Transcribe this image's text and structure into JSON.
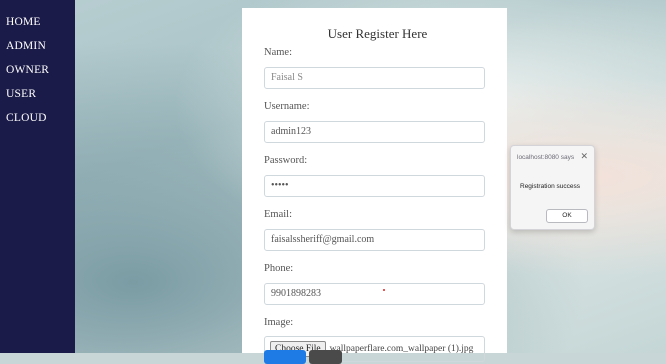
{
  "sidebar": {
    "items": [
      {
        "label": "HOME"
      },
      {
        "label": "ADMIN"
      },
      {
        "label": "OWNER"
      },
      {
        "label": "USER"
      },
      {
        "label": "CLOUD"
      }
    ]
  },
  "form": {
    "title": "User Register Here",
    "fields": {
      "name": {
        "label": "Name:",
        "value": "Faisal S"
      },
      "username": {
        "label": "Username:",
        "value": "admin123"
      },
      "password": {
        "label": "Password:",
        "value": "•••••"
      },
      "email": {
        "label": "Email:",
        "value": "faisalssheriff@gmail.com"
      },
      "phone": {
        "label": "Phone:",
        "value": "9901898283"
      },
      "image": {
        "label": "Image:",
        "button": "Choose File",
        "filename": "wallpaperflare.com_wallpaper (1).jpg"
      }
    }
  },
  "dialog": {
    "title": "localhost:8080 says",
    "close_icon": "close-icon",
    "message": "Registration success",
    "ok_label": "OK"
  },
  "colors": {
    "sidebar_bg": "#1b1b4a",
    "submit_button": "#1e7be6",
    "reset_button": "#4a4a4a"
  }
}
